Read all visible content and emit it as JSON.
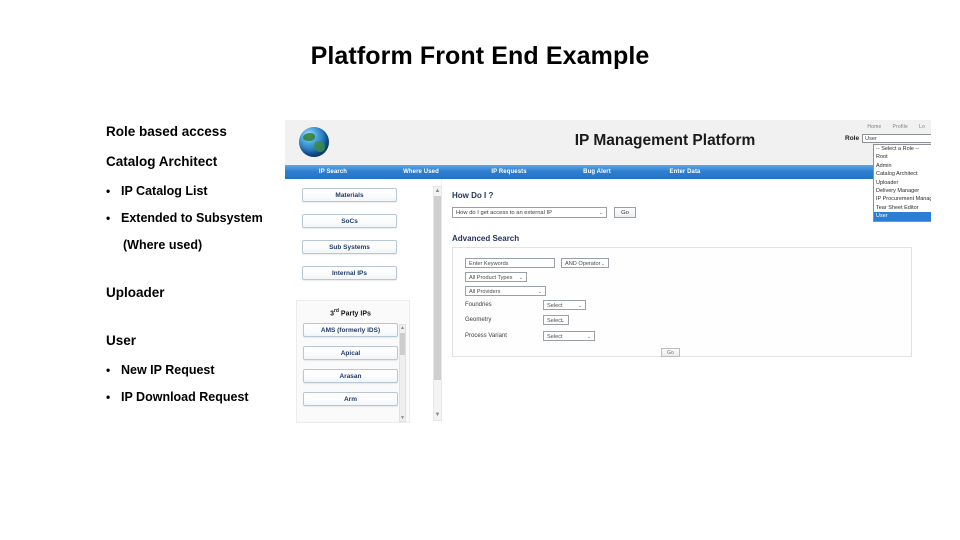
{
  "slide": {
    "title": "Platform Front End Example"
  },
  "outline": {
    "heading_roles": "Role based access",
    "role_catalog_architect": "Catalog Architect",
    "bullets_catalog": [
      "IP Catalog List",
      "Extended to Subsystem"
    ],
    "bullets_catalog_cont": "(Where used)",
    "role_uploader": "Uploader",
    "role_user": "User",
    "bullets_user": [
      "New IP Request",
      "IP Download Request"
    ],
    "bullet_glyph": "•"
  },
  "app": {
    "title": "IP Management Platform",
    "mini_menu": [
      "Home",
      "Profile",
      "Lo"
    ],
    "nav_items": [
      "IP Search",
      "Where Used",
      "IP Requests",
      "Bug Alert",
      "Enter Data"
    ],
    "role": {
      "label": "Role",
      "value": "User",
      "options": [
        "-- Select a Role --",
        "Root",
        "Admin",
        "Catalog Architect",
        "Uploader",
        "Delivery Manager",
        "IP Procurement Manager",
        "Tear Sheet Editor",
        "User"
      ],
      "selected_index": 8
    },
    "rail": {
      "buttons": [
        "Materials",
        "SoCs",
        "Sub Systems",
        "Internal IPs"
      ],
      "third_party_heading_prefix": "3",
      "third_party_heading_sup": "rd",
      "third_party_heading_rest": " Party IPs",
      "third_party_buttons": [
        "AMS (formerly IDS)",
        "Apical",
        "Arasan",
        "Arm"
      ],
      "scroll_up_glyph": "▲",
      "scroll_down_glyph": "▼"
    },
    "content": {
      "howdoi_label": "How Do I ?",
      "howdoi_value": "How do I get access to an external IP",
      "go_label": "Go",
      "advanced_search_label": "Advanced Search",
      "keywords_placeholder": "Enter Keywords",
      "operator_value": "AND Operator",
      "product_types_value": "All Product Types",
      "providers_value": "All Providers",
      "rows": [
        {
          "label": "Foundries",
          "value": "Select"
        },
        {
          "label": "Geometry",
          "value": "Select"
        },
        {
          "label": "Process Variant",
          "value": "Select"
        }
      ],
      "panel_go_label": "Go",
      "caret_glyph": "⌄"
    }
  },
  "colors": {
    "nav_blue": "#2e7fd0",
    "select_highlight": "#2a7fd4",
    "heading_navy": "#24355c",
    "button_text": "#1f3a6b"
  }
}
